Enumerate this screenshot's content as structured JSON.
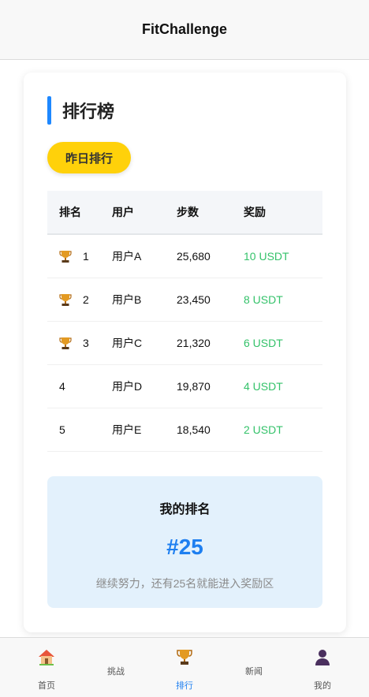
{
  "header": {
    "title": "FitChallenge"
  },
  "leaderboard": {
    "title": "排行榜",
    "filter_label": "昨日排行",
    "columns": [
      "排名",
      "用户",
      "步数",
      "奖励"
    ],
    "rows": [
      {
        "rank": "1",
        "user": "用户A",
        "steps": "25,680",
        "reward": "10 USDT",
        "trophy": true
      },
      {
        "rank": "2",
        "user": "用户B",
        "steps": "23,450",
        "reward": "8 USDT",
        "trophy": true
      },
      {
        "rank": "3",
        "user": "用户C",
        "steps": "21,320",
        "reward": "6 USDT",
        "trophy": true
      },
      {
        "rank": "4",
        "user": "用户D",
        "steps": "19,870",
        "reward": "4 USDT",
        "trophy": false
      },
      {
        "rank": "5",
        "user": "用户E",
        "steps": "18,540",
        "reward": "2 USDT",
        "trophy": false
      }
    ]
  },
  "my_rank": {
    "label": "我的排名",
    "value": "#25",
    "hint": "继续努力，还有25名就能进入奖励区"
  },
  "tabbar": {
    "tabs": [
      {
        "label": "首页",
        "icon": "home-icon",
        "active": false
      },
      {
        "label": "挑战",
        "icon": "",
        "active": false
      },
      {
        "label": "排行",
        "icon": "trophy-icon",
        "active": true
      },
      {
        "label": "新闻",
        "icon": "",
        "active": false
      },
      {
        "label": "我的",
        "icon": "user-icon",
        "active": false
      }
    ]
  },
  "colors": {
    "accent": "#1e7ff0",
    "title_bar": "#1e88ff",
    "filter_button": "#ffd10a",
    "reward": "#34c26a",
    "my_rank_bg": "#e3f1fc"
  }
}
